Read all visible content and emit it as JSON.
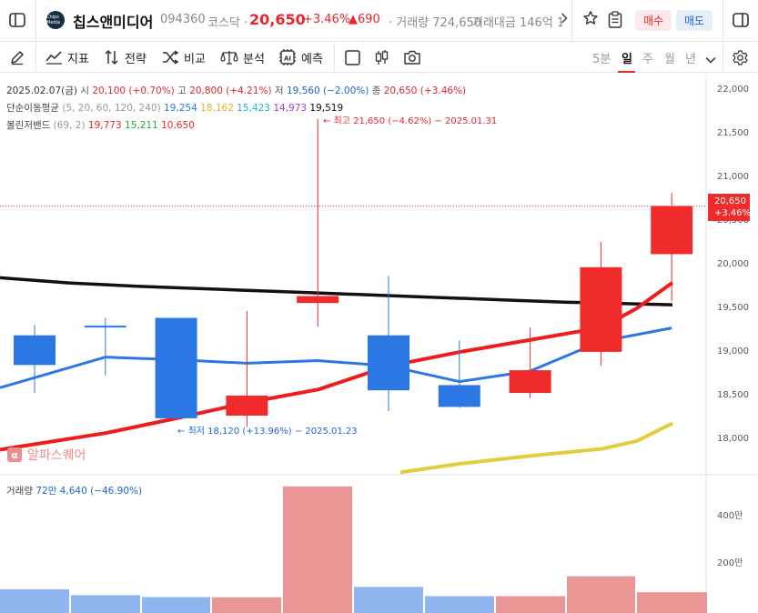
{
  "header": {
    "logo_text": "Chips Media",
    "stock_name": "칩스앤미디어",
    "code": "094360",
    "market": "코스닥 ·",
    "price": "20,650",
    "change_pct": "+3.46%",
    "change_abs": "▲690",
    "volume_label": "· 거래량 724,650",
    "amount_label": "거래대금 146억 1",
    "buy_label": "매수",
    "sell_label": "매도"
  },
  "toolbar": {
    "indicators": "지표",
    "strategy": "전략",
    "compare": "비교",
    "analysis": "분석",
    "forecast": "예측",
    "periods": [
      "5분",
      "일",
      "주",
      "월",
      "년"
    ],
    "active_period": "일"
  },
  "legend": {
    "ohlc": {
      "date": "2025.02.07(금)",
      "open_label": "시",
      "open_value": "20,100 (+0.70%)",
      "high_label": "고",
      "high_value": "20,800 (+4.21%)",
      "low_label": "저",
      "low_value": "19,560 (−2.00%)",
      "close_label": "종",
      "close_value": "20,650 (+3.46%)"
    },
    "ma": {
      "label": "단순이동평균",
      "params": "(5, 20, 60, 120, 240)",
      "values": [
        "19,254",
        "18,162",
        "15,423",
        "14,973",
        "19,519"
      ]
    },
    "bollinger": {
      "label": "볼린저밴드",
      "params": "(69, 2)",
      "values": [
        "19,773",
        "15,211",
        "10,650"
      ]
    },
    "volume": {
      "label": "거래량",
      "ma_values": "72만 4,640",
      "change": "(−46.90%)"
    }
  },
  "annotations": {
    "high": "최고 21,650 (−4.62%) − 2025.01.31",
    "low": "최저 18,120 (+13.96%) − 2025.01.23"
  },
  "current_price_label": {
    "price": "20,650",
    "change": "+3.46%"
  },
  "watermark": {
    "logo": "α",
    "text": "알파스퀘어"
  },
  "colors": {
    "up": "#ef2b2b",
    "down": "#2b78e4",
    "ma5": "#2b78e4",
    "ma20": "#ee1c1c",
    "ma60": "#e3cc3c",
    "ma240": "#111111"
  },
  "chart_data": {
    "type": "candlestick",
    "y_ticks": [
      "22,000",
      "21,500",
      "21,000",
      "20,500",
      "20,000",
      "19,500",
      "19,000",
      "18,500",
      "18,000"
    ],
    "y_tick_values": [
      22000,
      21500,
      21000,
      20500,
      20000,
      19500,
      19000,
      18500,
      18000
    ],
    "ylim": [
      17600,
      22200
    ],
    "candles": [
      {
        "o": 19170,
        "h": 19290,
        "l": 18510,
        "c": 18830
      },
      {
        "o": 19280,
        "h": 19370,
        "l": 18710,
        "c": 19270
      },
      {
        "o": 19370,
        "h": 19370,
        "l": 18210,
        "c": 18220
      },
      {
        "o": 18250,
        "h": 19450,
        "l": 18120,
        "c": 18480
      },
      {
        "o": 19540,
        "h": 21650,
        "l": 19270,
        "c": 19620
      },
      {
        "o": 19170,
        "h": 19850,
        "l": 18300,
        "c": 18540
      },
      {
        "o": 18600,
        "h": 19110,
        "l": 18340,
        "c": 18350
      },
      {
        "o": 18510,
        "h": 19260,
        "l": 18450,
        "c": 18770
      },
      {
        "o": 18980,
        "h": 20240,
        "l": 18820,
        "c": 19950
      },
      {
        "o": 20100,
        "h": 20800,
        "l": 19560,
        "c": 20650
      }
    ],
    "ma5": [
      18650,
      18920,
      18890,
      18850,
      18880,
      18820,
      18640,
      18760,
      19100,
      19254
    ],
    "ma20": [
      17860,
      18050,
      18220,
      18400,
      18550,
      18820,
      18980,
      19120,
      19260,
      19480,
      19773
    ],
    "ma60": [
      17600,
      17700,
      17790,
      17870,
      17960,
      18162
    ],
    "ma240": [
      19830,
      19770,
      19730,
      19700,
      19670,
      19640,
      19610,
      19580,
      19550,
      19530,
      19519
    ],
    "volume_ticks": [
      "400만",
      "200만"
    ],
    "volume_tick_values": [
      4000000,
      2000000
    ],
    "volume": [
      850000,
      600000,
      520000,
      510000,
      5200000,
      950000,
      560000,
      560000,
      1400000,
      724650
    ],
    "volume_up": [
      false,
      false,
      false,
      true,
      true,
      false,
      false,
      true,
      true,
      true
    ]
  }
}
